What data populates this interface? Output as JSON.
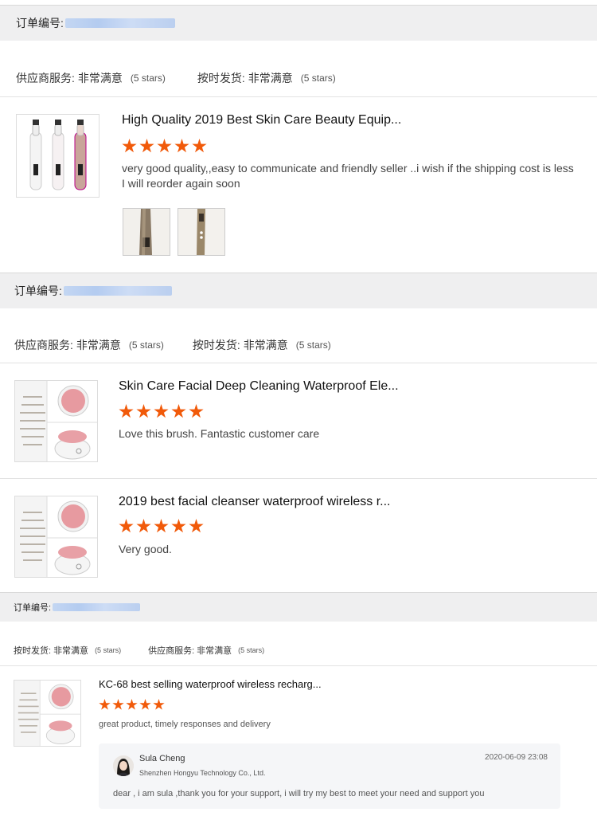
{
  "order1": {
    "order_label": "订单编号:",
    "supplier_label": "供应商服务:",
    "supplier_value": "非常满意",
    "supplier_stars": "(5 stars)",
    "shipping_label": "按时发货:",
    "shipping_value": "非常满意",
    "shipping_stars": "(5 stars)",
    "items": [
      {
        "title": "High Quality 2019 Best Skin Care Beauty Equip...",
        "rating": 5,
        "review_line1": "very good quality,,easy to communicate and friendly seller ..i wish if the shipping cost is less",
        "review_line2": "I will reorder again soon"
      }
    ]
  },
  "order2": {
    "order_label": "订单编号:",
    "supplier_label": "供应商服务:",
    "supplier_value": "非常满意",
    "supplier_stars": "(5 stars)",
    "shipping_label": "按时发货:",
    "shipping_value": "非常满意",
    "shipping_stars": "(5 stars)",
    "items": [
      {
        "title": "Skin Care Facial Deep Cleaning Waterproof Ele...",
        "rating": 5,
        "review": "Love this brush. Fantastic customer care"
      },
      {
        "title": "2019 best facial cleanser waterproof wireless r...",
        "rating": 5,
        "review": "Very good."
      }
    ]
  },
  "order3": {
    "order_label": "订单编号:",
    "shipping_label": "按时发货:",
    "shipping_value": "非常满意",
    "shipping_stars": "(5 stars)",
    "supplier_label": "供应商服务:",
    "supplier_value": "非常满意",
    "supplier_stars": "(5 stars)",
    "items": [
      {
        "title": "KC-68 best selling waterproof wireless recharg...",
        "rating": 5,
        "review": "great product, timely responses and delivery"
      }
    ],
    "reply": {
      "name": "Sula Cheng",
      "company": "Shenzhen Hongyu Technology Co., Ltd.",
      "timestamp": "2020-06-09 23:08",
      "message": "dear , i am sula ,thank you for your support, i will try my best to meet your need and support you"
    }
  },
  "colors": {
    "star": "#f15a0a",
    "header_bg": "#efeff0",
    "reply_bg": "#f5f6f8"
  }
}
